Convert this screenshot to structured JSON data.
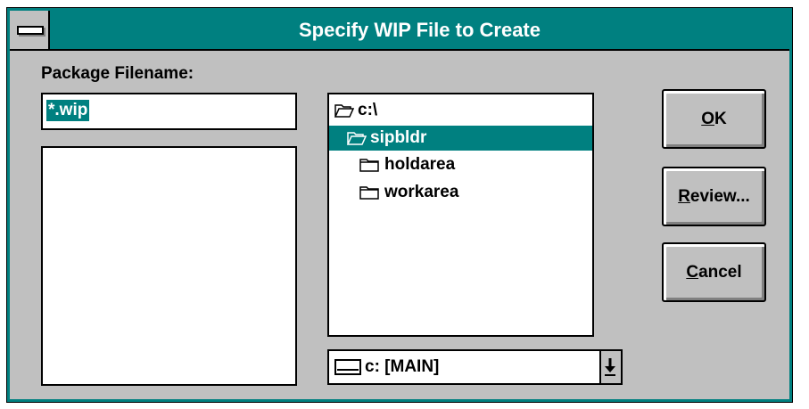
{
  "window": {
    "title": "Specify WIP File to Create"
  },
  "form": {
    "package_label": "Package Filename:",
    "filename_value": "*.wip"
  },
  "directories": [
    {
      "name": "c:\\",
      "icon": "open-folder-icon",
      "selected": false
    },
    {
      "name": "sipbldr",
      "icon": "open-folder-icon",
      "selected": true
    },
    {
      "name": "holdarea",
      "icon": "folder-icon",
      "selected": false
    },
    {
      "name": "workarea",
      "icon": "folder-icon",
      "selected": false
    }
  ],
  "drive": {
    "value": "c: [MAIN]",
    "icon": "drive-icon"
  },
  "buttons": {
    "ok": {
      "mnemonic": "O",
      "rest": "K"
    },
    "review": {
      "mnemonic": "R",
      "rest": "eview..."
    },
    "cancel": {
      "mnemonic": "C",
      "rest": "ancel"
    }
  },
  "colors": {
    "accent": "#008080",
    "face": "#c0c0c0"
  }
}
